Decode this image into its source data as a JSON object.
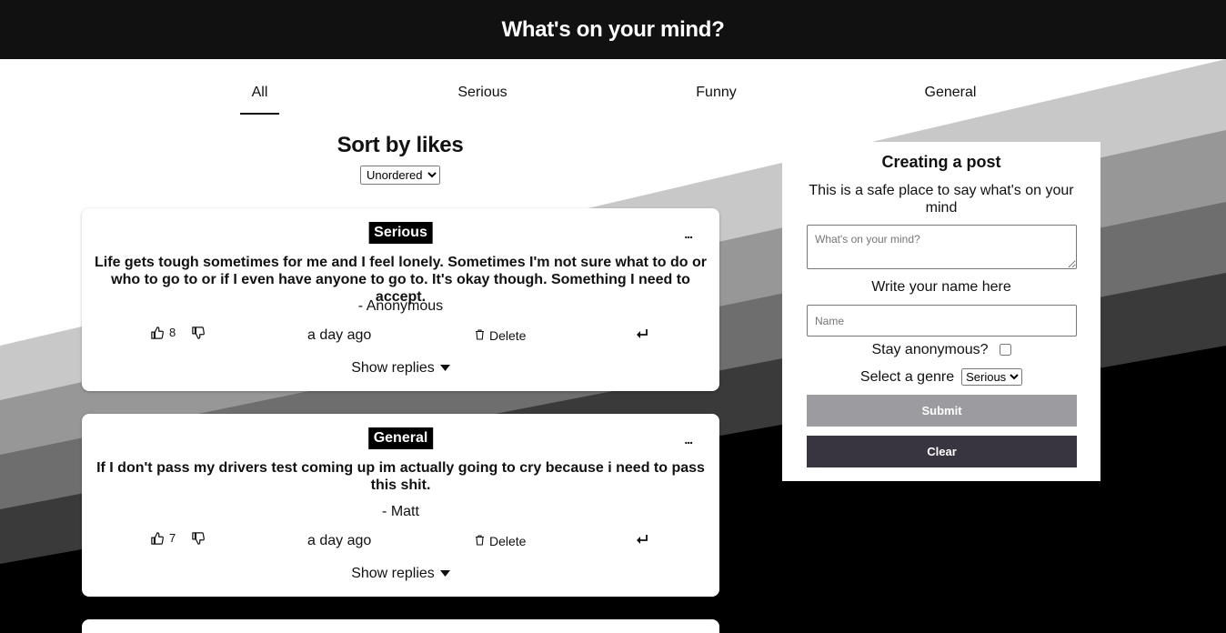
{
  "header": {
    "title": "What's on your mind?"
  },
  "tabs": [
    {
      "label": "All",
      "active": true
    },
    {
      "label": "Serious"
    },
    {
      "label": "Funny"
    },
    {
      "label": "General"
    }
  ],
  "sort": {
    "title": "Sort by likes",
    "selected": "Unordered"
  },
  "posts": [
    {
      "genre": "Serious",
      "menu": "...",
      "text": "Life gets tough sometimes for me and I feel lonely. Sometimes I'm not sure what to do or who to go to or if I even have anyone to go to. It's okay though. Something I need to accept.",
      "author": "- Anonymous",
      "likes": "8",
      "time": "a day ago",
      "delete_label": "Delete",
      "show_replies": "Show replies"
    },
    {
      "genre": "General",
      "menu": "...",
      "text": "If I don't pass my drivers test coming up im actually going to cry because i need to pass this shit.",
      "author": "- Matt",
      "likes": "7",
      "time": "a day ago",
      "delete_label": "Delete",
      "show_replies": "Show replies"
    }
  ],
  "create": {
    "title": "Creating a post",
    "subtitle": "This is a safe place to say what's on your mind",
    "post_placeholder": "What's on your mind?",
    "name_label": "Write your name here",
    "name_placeholder": "Name",
    "anonymous_label": "Stay anonymous?",
    "genre_label": "Select a genre",
    "genre_selected": "Serious",
    "submit_label": "Submit",
    "clear_label": "Clear"
  }
}
